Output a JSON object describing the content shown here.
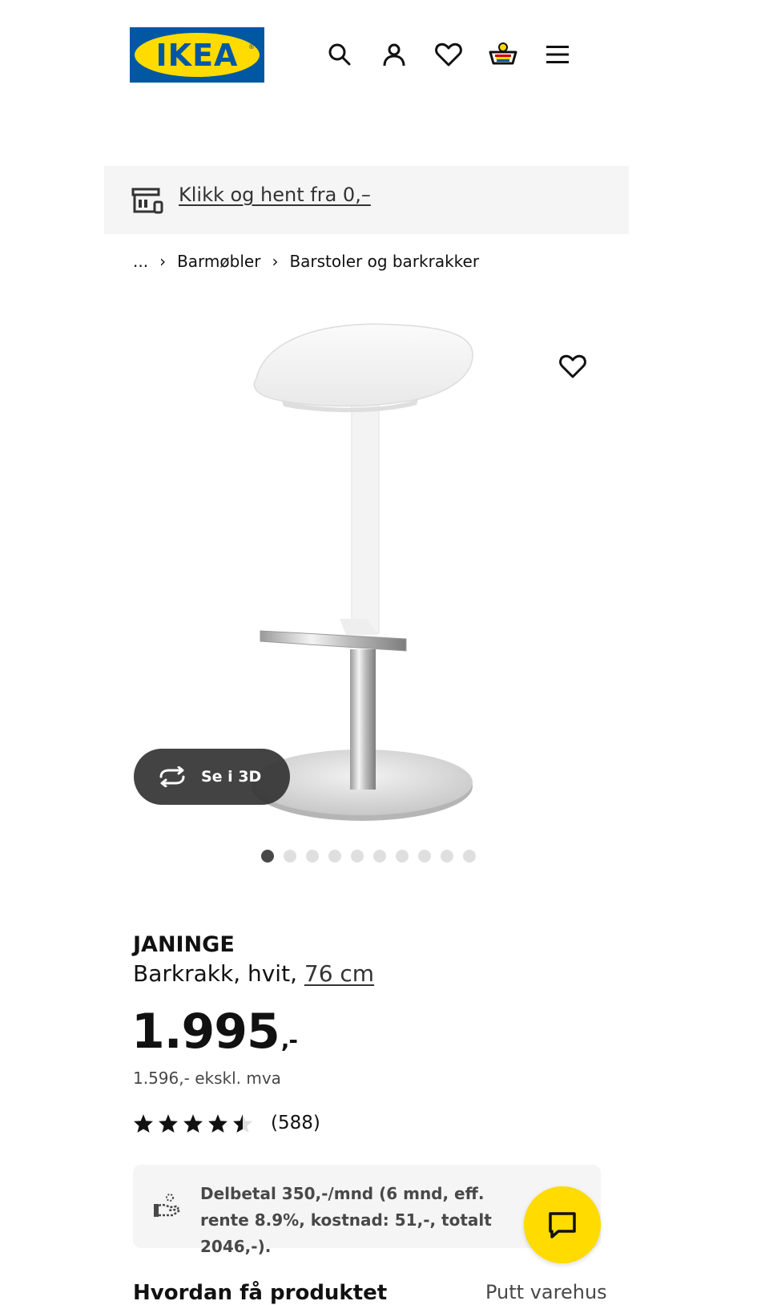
{
  "header": {
    "logo_text": "IKEA",
    "logo_colors": {
      "blue": "#0058a3",
      "yellow": "#ffdb00"
    },
    "icons": [
      "search-icon",
      "account-icon",
      "heart-icon",
      "shopping-bag-icon",
      "menu-icon"
    ]
  },
  "banner": {
    "icon": "store-icon",
    "link_text": "Klikk og hent fra 0,–"
  },
  "breadcrumb": {
    "ellipsis": "...",
    "items": [
      "Barmøbler",
      "Barstoler og barkrakker"
    ]
  },
  "gallery": {
    "view_3d_label": "Se i 3D",
    "dot_count": 10,
    "active_dot": 1
  },
  "product": {
    "name": "JANINGE",
    "description": "Barkrakk, hvit,",
    "size_link": "76 cm",
    "price_main": "1.995",
    "price_suffix": ",-",
    "price_ex_vat": "1.596,- ekskl. mva",
    "rating_value": 4.5,
    "rating_max": 5,
    "review_count": "(588)"
  },
  "installment": {
    "text": "Delbetal 350,-/mnd (6 mnd, eff. rente 8.9%, kostnad: 51,-, totalt 2046,-)."
  },
  "chat": {
    "icon": "chat-icon",
    "color": "#ffdb00"
  },
  "bottom": {
    "left_heading": "Hvordan få produktet",
    "right_text": "Putt varehus"
  }
}
